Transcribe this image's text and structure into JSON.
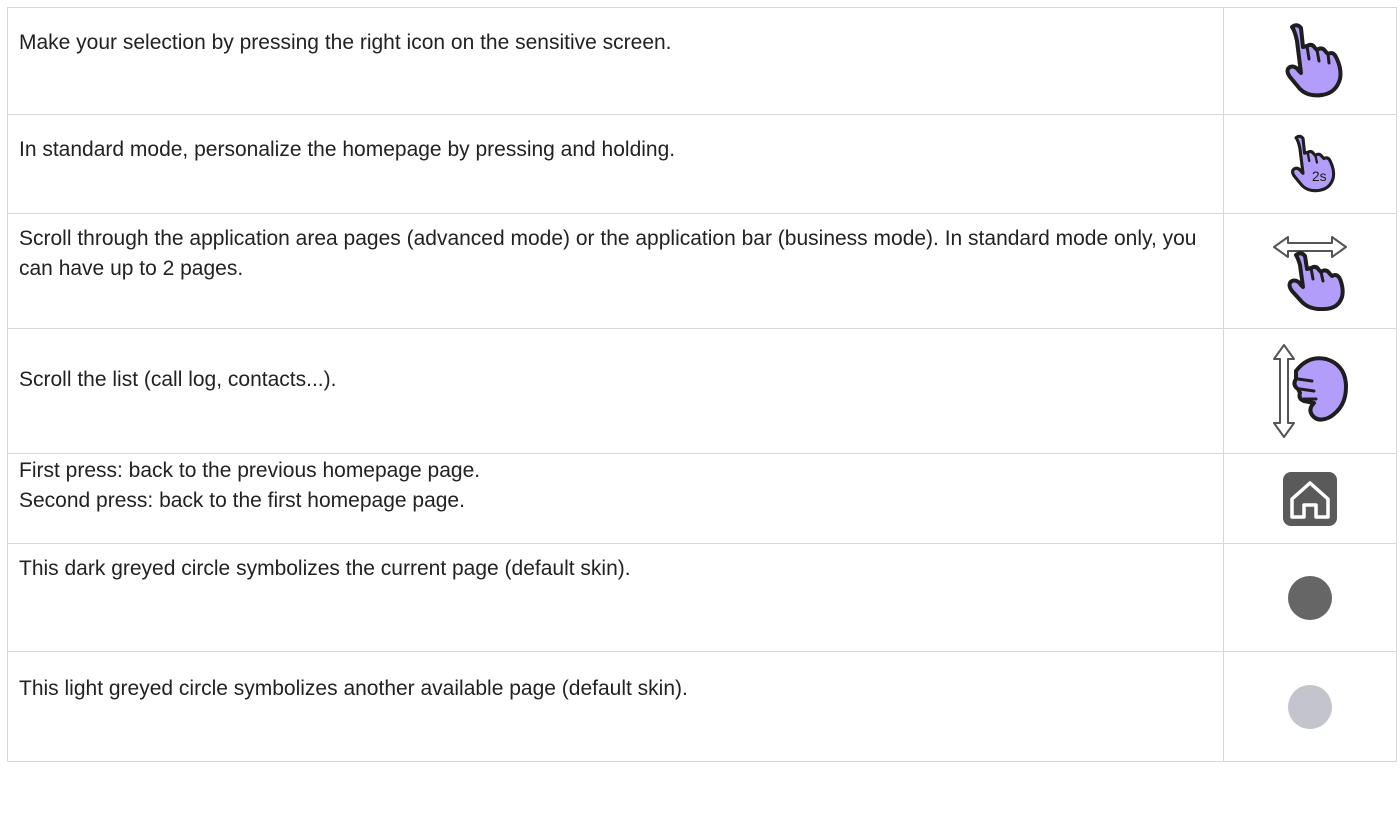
{
  "rows": [
    {
      "text": "Make your selection by pressing the right icon on the sensitive screen.",
      "icon": "tap-hand-icon"
    },
    {
      "text": "In standard mode, personalize the homepage by pressing and holding.",
      "icon": "long-press-hand-icon",
      "icon_badge": "2s"
    },
    {
      "text": "Scroll through the application area pages (advanced mode) or the application bar (business mode). In standard mode only, you can have up to 2 pages.",
      "icon": "horizontal-swipe-hand-icon"
    },
    {
      "text": "Scroll the list (call log, contacts...).",
      "icon": "vertical-scroll-hand-icon"
    },
    {
      "lines": [
        "First press: back to the previous homepage page.",
        "Second press: back to the first homepage page."
      ],
      "icon": "home-icon"
    },
    {
      "text": "This dark greyed circle symbolizes the current page (default skin).",
      "icon": "dark-grey-dot-icon",
      "color": "#666666"
    },
    {
      "text": "This light greyed circle symbolizes another available page (default skin).",
      "icon": "light-grey-dot-icon",
      "color": "#c4c4cc"
    }
  ],
  "colors": {
    "hand_fill": "#b39dfb",
    "hand_stroke": "#1e1e1e",
    "home_bg": "#5a5a5a",
    "border": "#d8d8d8"
  }
}
